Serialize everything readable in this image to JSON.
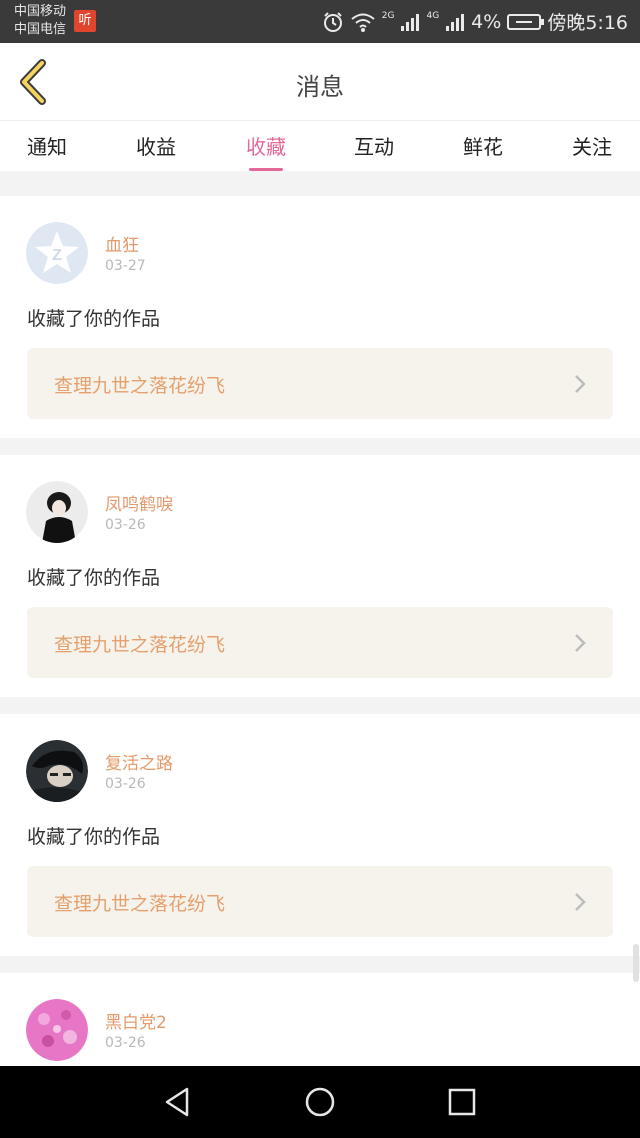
{
  "status_bar": {
    "carrier_1": "中国移动",
    "carrier_2": "中国电信",
    "listen_badge": "听",
    "net_2g": "2G",
    "net_4g": "4G",
    "battery": "4%",
    "time": "傍晚5:16"
  },
  "header": {
    "title": "消息"
  },
  "tabs": [
    {
      "label": "通知"
    },
    {
      "label": "收益"
    },
    {
      "label": "收藏",
      "active": true
    },
    {
      "label": "互动"
    },
    {
      "label": "鲜花"
    },
    {
      "label": "关注"
    }
  ],
  "items": [
    {
      "user": "血狂",
      "date": "03-27",
      "action": "收藏了你的作品",
      "work": "查理九世之落花纷飞",
      "avatar": "qq-default-avatar"
    },
    {
      "user": "凤鸣鹤唳",
      "date": "03-26",
      "action": "收藏了你的作品",
      "work": "查理九世之落花纷飞",
      "avatar": "user-photo-avatar"
    },
    {
      "user": "复活之路",
      "date": "03-26",
      "action": "收藏了你的作品",
      "work": "查理九世之落花纷飞",
      "avatar": "anime-avatar"
    },
    {
      "user": "黑白党2",
      "date": "03-26",
      "avatar": "pink-pattern-avatar"
    }
  ],
  "colors": {
    "accent": "#e4699a",
    "username": "#e39a6b",
    "work_title": "#e5a06e",
    "work_box": "#f5f3ec",
    "status_bar": "#3a3a3a"
  },
  "icons": [
    "back-arrow-icon",
    "alarm-icon",
    "wifi-icon",
    "signal-icon",
    "battery-icon",
    "chevron-right-icon",
    "nav-back-icon",
    "nav-home-icon",
    "nav-recents-icon"
  ]
}
